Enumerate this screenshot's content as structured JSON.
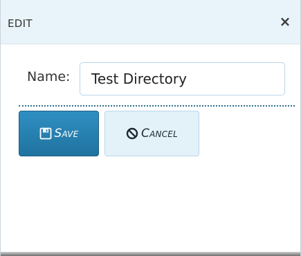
{
  "dialog": {
    "title": "EDIT",
    "close_symbol": "×",
    "icons": {
      "close": "close-icon",
      "save": "floppy-disk-icon",
      "cancel": "ban-circle-icon"
    }
  },
  "form": {
    "name_label": "Name:",
    "name_value": "Test Directory"
  },
  "actions": {
    "save_label": "Save",
    "cancel_label": "Cancel"
  },
  "colors": {
    "titlebar_bg": "#e9f4fa",
    "save_bg": "#2a85b8",
    "cancel_bg": "#e3f1f9",
    "divider": "#2b6b8e"
  }
}
